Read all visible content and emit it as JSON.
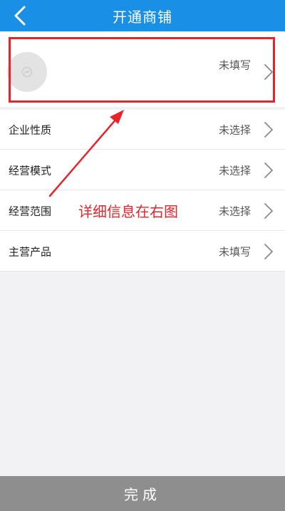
{
  "header": {
    "title": "开通商铺",
    "back_icon": "chevron-left-icon"
  },
  "avatar_row": {
    "value": "未填写",
    "avatar_icon": "image-placeholder-icon"
  },
  "list": {
    "items": [
      {
        "label": "企业性质",
        "value": "未选择"
      },
      {
        "label": "经营模式",
        "value": "未选择"
      },
      {
        "label": "经营范围",
        "value": "未选择"
      },
      {
        "label": "主营产品",
        "value": "未填写"
      }
    ]
  },
  "annotation": {
    "text": "详细信息在右图"
  },
  "footer": {
    "done_label": "完成"
  },
  "colors": {
    "header_bg": "#1a8fe6",
    "annotation_red": "#e8232a",
    "done_bg": "#8e8e8e",
    "page_bg": "#f2f2f4"
  }
}
